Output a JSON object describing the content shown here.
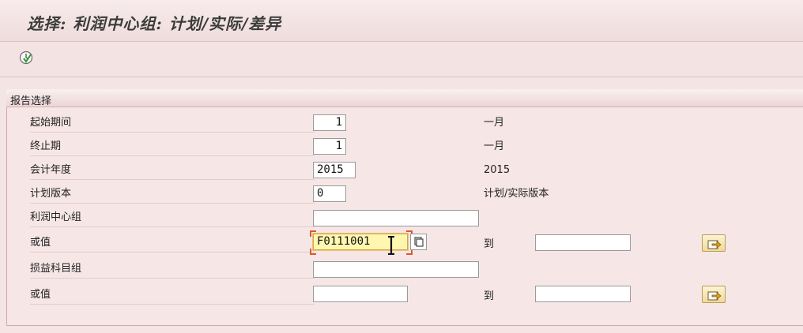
{
  "page": {
    "title": "选择: 利润中心组: 计划/实际/差异"
  },
  "toolbar": {
    "execute_icon": "execute-clock-icon"
  },
  "frame": {
    "title": "报告选择"
  },
  "fields": {
    "start_period": {
      "label": "起始期间",
      "value": "1",
      "desc": "一月"
    },
    "end_period": {
      "label": "终止期",
      "value": "1",
      "desc": "一月"
    },
    "fiscal_year": {
      "label": "会计年度",
      "value": "2015",
      "desc": "2015"
    },
    "plan_version": {
      "label": "计划版本",
      "value": "0",
      "desc": "计划/实际版本"
    },
    "profit_center_group": {
      "label": "利润中心组",
      "value": ""
    },
    "profit_center_or_value": {
      "label": "或值",
      "value": "F0111001",
      "to_label": "到",
      "to_value": ""
    },
    "account_group": {
      "label": "损益科目组",
      "value": ""
    },
    "account_or_value": {
      "label": "或值",
      "value": "",
      "to_label": "到",
      "to_value": ""
    }
  },
  "colors": {
    "background": "#f4e4e4",
    "focus_field": "#fff7b0",
    "multiple_selection_button": "#f0d99a"
  }
}
